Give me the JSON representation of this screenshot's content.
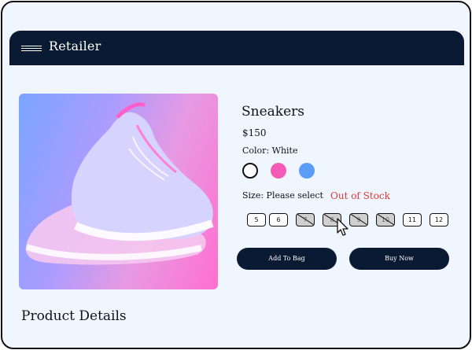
{
  "header": {
    "brand": "Retailer"
  },
  "product": {
    "title": "Sneakers",
    "price": "$150",
    "color_label": "Color: White",
    "colors": [
      {
        "name": "white",
        "hex": "#ffffff"
      },
      {
        "name": "pink",
        "hex": "#f45bb6"
      },
      {
        "name": "blue",
        "hex": "#5a9cf8"
      }
    ],
    "size_label": "Size: Please select",
    "stock_status": "Out of Stock",
    "sizes": [
      {
        "label": "5",
        "available": true
      },
      {
        "label": "6",
        "available": true
      },
      {
        "label": "7",
        "available": false
      },
      {
        "label": "8",
        "available": false
      },
      {
        "label": "9",
        "available": false
      },
      {
        "label": "10",
        "available": false
      },
      {
        "label": "11",
        "available": true
      },
      {
        "label": "12",
        "available": true
      }
    ],
    "add_to_bag": "Add To Bag",
    "buy_now": "Buy Now"
  },
  "sections": {
    "details_title": "Product Details"
  },
  "colors": {
    "header_bg": "#0a1a32",
    "page_bg": "#eff6ff",
    "stock_red": "#e53935"
  }
}
